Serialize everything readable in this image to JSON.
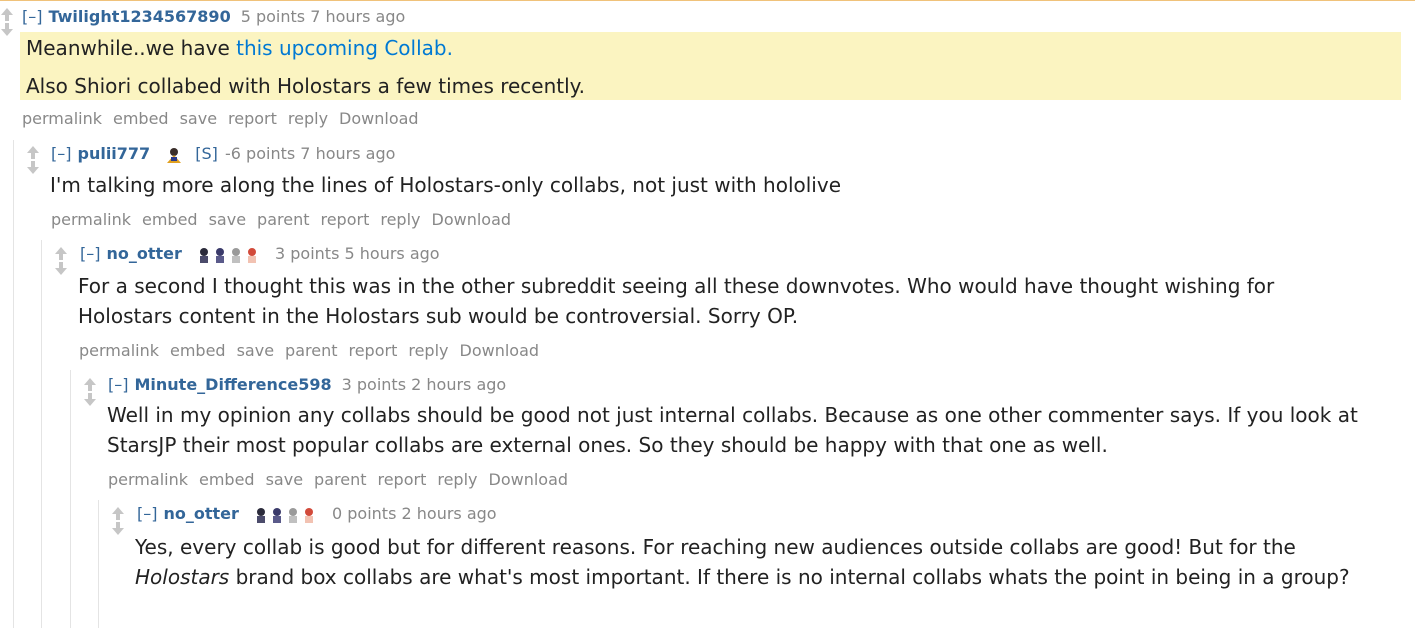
{
  "ui": {
    "expand_label": "[–]",
    "upvote_icon": "upvote-arrow-icon",
    "downvote_icon": "downvote-arrow-icon",
    "buttons": {
      "permalink": "permalink",
      "embed": "embed",
      "save": "save",
      "parent": "parent",
      "report": "report",
      "reply": "reply",
      "download": "Download"
    }
  },
  "comments": [
    {
      "author": "Twilight1234567890",
      "score": "5 points",
      "time": "7 hours ago",
      "body_line1_prefix": "Meanwhile..we have ",
      "body_line1_link": "this upcoming Collab.",
      "body_line2": "Also Shiori collabed with Holostars a few times recently."
    },
    {
      "author": "pulii777",
      "submitter_tag": "[S]",
      "score": "-6 points",
      "time": "7 hours ago",
      "body": "I'm talking more along the lines of Holostars-only collabs, not just with hololive"
    },
    {
      "author": "no_otter",
      "score": "3 points",
      "time": "5 hours ago",
      "body": "For a second I thought this was in the other subreddit seeing all these downvotes. Who would have thought wishing for Holostars content in the Holostars sub would be controversial. Sorry OP."
    },
    {
      "author": "Minute_Difference598",
      "score": "3 points",
      "time": "2 hours ago",
      "body": "Well in my opinion any collabs should be good not just internal collabs. Because as one other commenter says. If you look at StarsJP their most popular collabs are external ones. So they should be happy with that one as well."
    },
    {
      "author": "no_otter",
      "score": "0 points",
      "time": "2 hours ago",
      "body_prefix": "Yes, every collab is good but for different reasons. For reaching new audiences outside collabs are good! But for the ",
      "body_italic": "Holostars",
      "body_suffix": " brand box collabs are what's most important. If there is no internal collabs whats the point in being in a group?"
    }
  ]
}
